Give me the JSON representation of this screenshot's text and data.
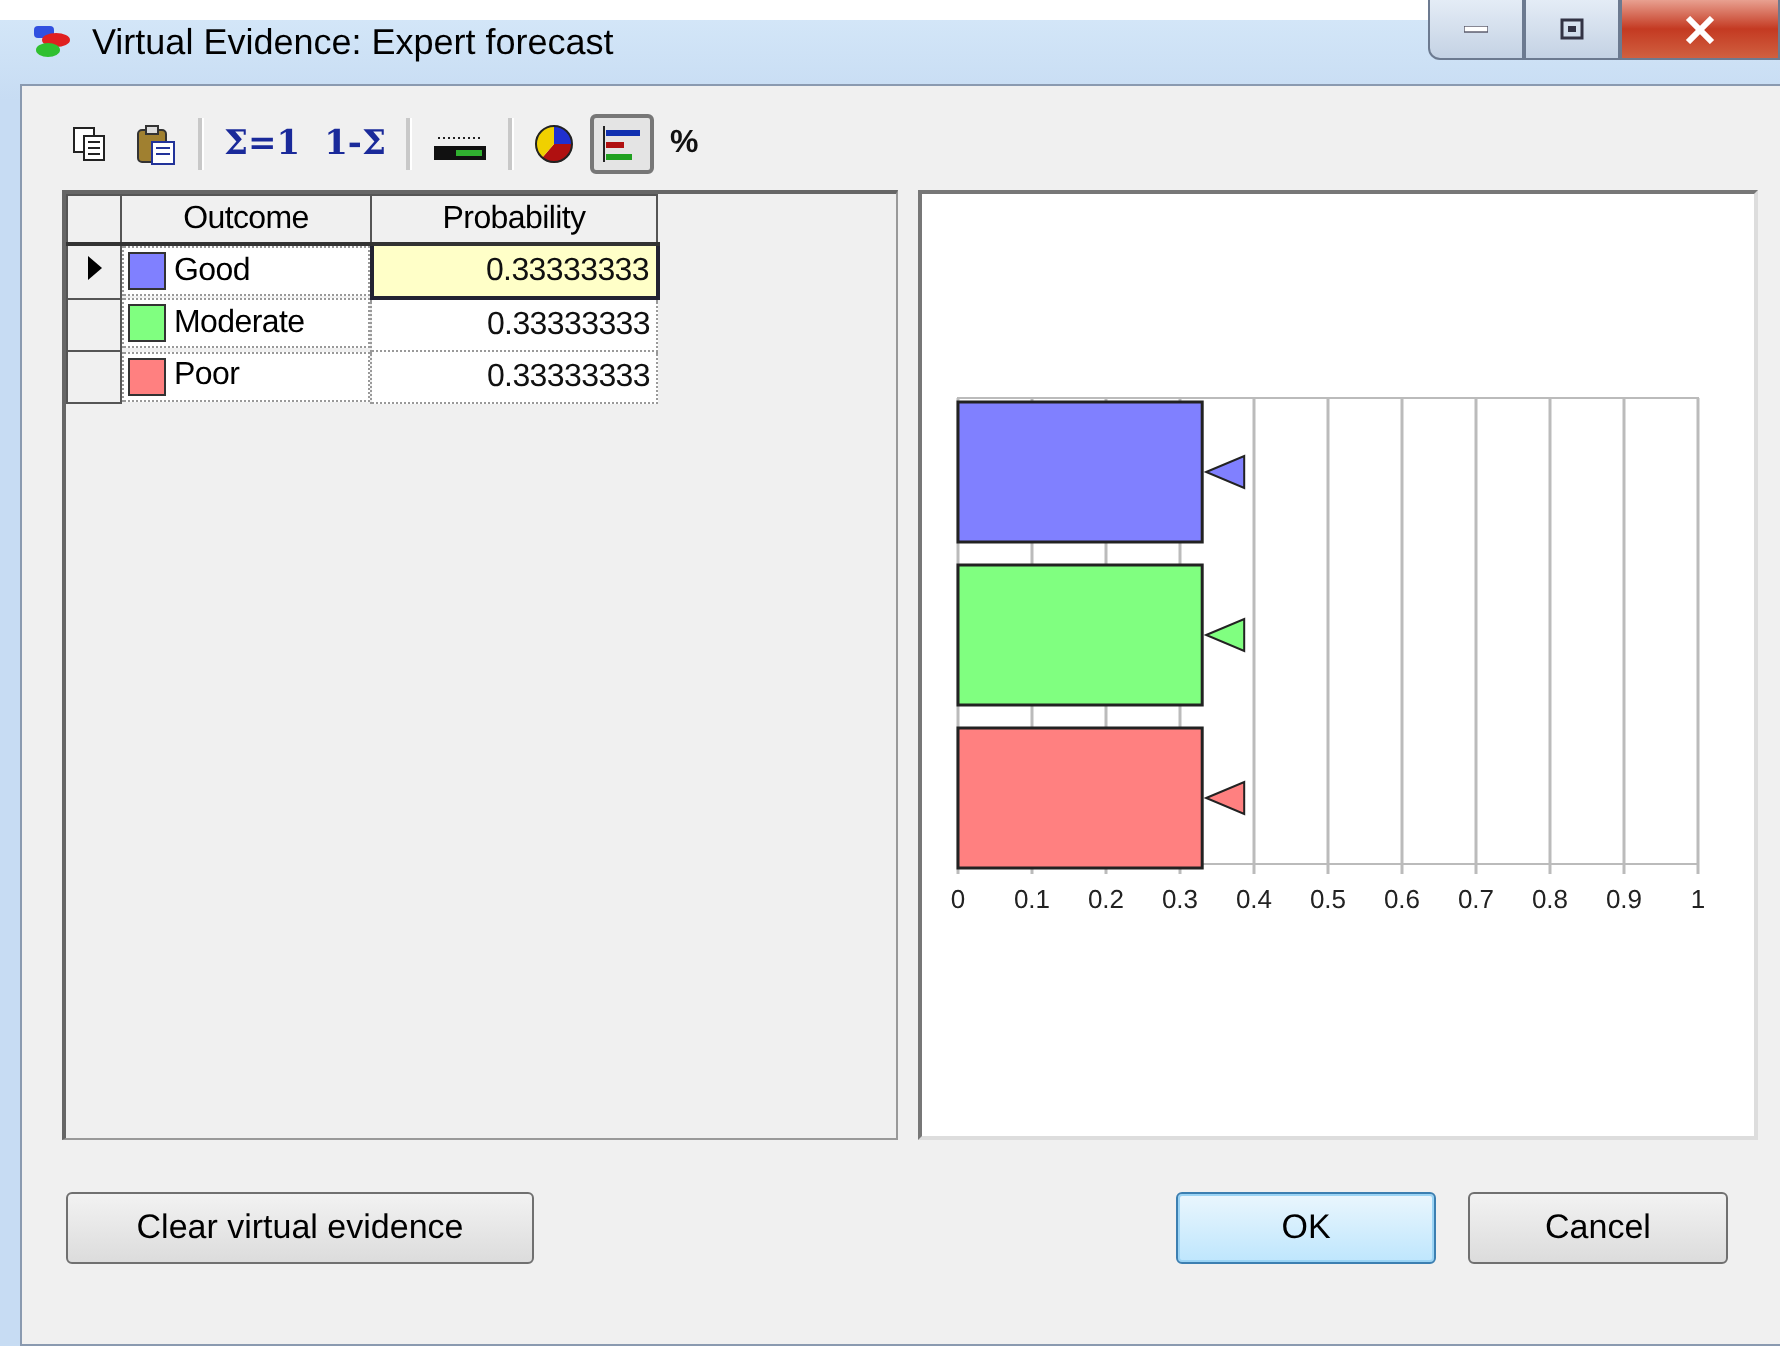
{
  "window": {
    "title": "Virtual Evidence: Expert forecast"
  },
  "toolbar": [
    {
      "kind": "copy"
    },
    {
      "kind": "paste"
    },
    {
      "kind": "separator"
    },
    {
      "kind": "glyph",
      "label": "Σ=1"
    },
    {
      "kind": "glyph",
      "label": "1-Σ"
    },
    {
      "kind": "separator"
    },
    {
      "kind": "range"
    },
    {
      "kind": "separator"
    },
    {
      "kind": "pie",
      "pressed": false
    },
    {
      "kind": "bars",
      "pressed": true
    },
    {
      "kind": "glyph",
      "label": "%"
    }
  ],
  "table": {
    "columns": [
      "Outcome",
      "Probability"
    ],
    "rows": [
      {
        "outcome": "Good",
        "color": "#8080ff",
        "probability": "0.33333333",
        "selected": true
      },
      {
        "outcome": "Moderate",
        "color": "#80ff80",
        "probability": "0.33333333",
        "selected": false
      },
      {
        "outcome": "Poor",
        "color": "#ff8080",
        "probability": "0.33333333",
        "selected": false
      }
    ]
  },
  "chart": {
    "chart_data": {
      "type": "bar",
      "orientation": "horizontal",
      "grid": true,
      "xlim": [
        0,
        1
      ],
      "xticks": [
        0,
        0.1,
        0.2,
        0.3,
        0.4,
        0.5,
        0.6,
        0.7,
        0.8,
        0.9,
        1
      ],
      "values": [
        0.33,
        0.33,
        0.33
      ]
    }
  },
  "buttons": [
    {
      "label": "Clear virtual evidence",
      "default": false
    },
    {
      "label": "OK",
      "default": true
    },
    {
      "label": "Cancel",
      "default": false
    }
  ]
}
